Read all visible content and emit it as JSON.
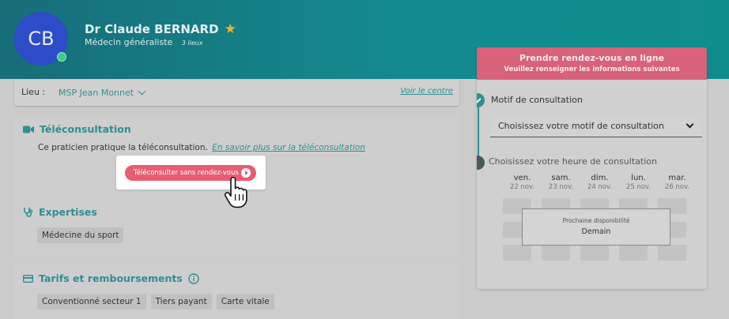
{
  "doctor": {
    "initials": "CB",
    "name": "Dr Claude BERNARD",
    "specialty": "Médecin généraliste",
    "places": "3 lieux"
  },
  "location": {
    "label": "Lieu :",
    "value": "MSP Jean Monnet",
    "link": "Voir le centre"
  },
  "teleconsultation": {
    "title": "Téléconsultation",
    "text": "Ce praticien pratique la téléconsultation.",
    "link": "En savoir plus sur la téléconsultation",
    "button": "Téléconsulter sans rendez-vous"
  },
  "expertises": {
    "title": "Expertises",
    "items": [
      "Médecine du sport"
    ]
  },
  "tarifs": {
    "title": "Tarifs et remboursements",
    "items": [
      "Conventionné secteur 1",
      "Tiers payant",
      "Carte vitale"
    ]
  },
  "booking": {
    "title": "Prendre rendez-vous en ligne",
    "subtitle": "Veuillez renseigner les informations suivantes",
    "motif_label": "Motif de consultation",
    "motif_placeholder": "Choisissez votre motif de consultation",
    "heure_label": "Choisissez votre heure de consultation",
    "days": [
      {
        "name": "ven.",
        "date": "22 nov."
      },
      {
        "name": "sam.",
        "date": "23 nov."
      },
      {
        "name": "dim.",
        "date": "24 nov."
      },
      {
        "name": "lun.",
        "date": "25 nov."
      },
      {
        "name": "mar.",
        "date": "26 nov."
      }
    ],
    "next_label": "Prochaine disponibilité",
    "next_value": "Demain"
  },
  "colors": {
    "brand": "#138a8f",
    "accent": "#e95d72",
    "avatar": "#2d4cc8",
    "star": "#e6b62c"
  },
  "icons": [
    "star-icon",
    "chevron-down-icon",
    "video-camera-icon",
    "stethoscope-icon",
    "credit-card-icon",
    "info-icon",
    "play-icon",
    "check-icon",
    "hand-pointer-icon"
  ]
}
